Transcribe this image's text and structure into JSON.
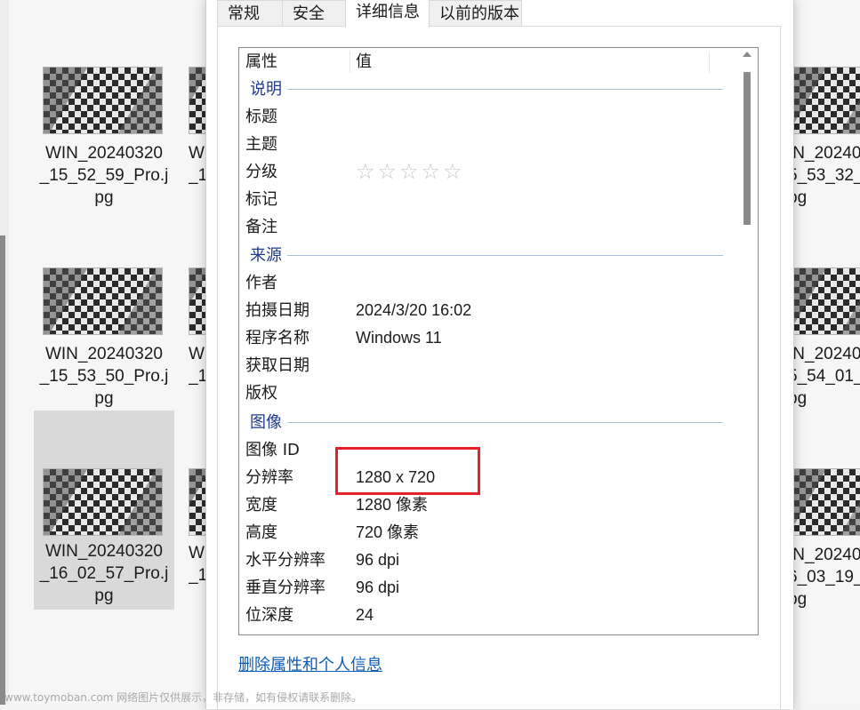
{
  "explorer": {
    "left_files": [
      "WIN_20240320\n_15_52_59_Pro.j\npg",
      "WIN_20240320\n_15_53_50_Pro.j\npg",
      "WIN_20240320\n_16_02_57_Pro.j\npg"
    ],
    "middle_partial": [
      "W\n_1",
      "W\n_1",
      "W\n_1"
    ],
    "right_partial": [
      "IN_20240\n5_53_32_\npg",
      "IN_20240\n5_54_01_\npg",
      "IN_20240\n6_03_19_\npg"
    ]
  },
  "dialog": {
    "tabs": [
      "常规",
      "安全",
      "详细信息",
      "以前的版本"
    ],
    "active_tab": "详细信息",
    "columns": {
      "property": "属性",
      "value": "值"
    },
    "groups": {
      "description": "说明",
      "origin": "来源",
      "image": "图像"
    },
    "rows": {
      "title": {
        "label": "标题",
        "value": ""
      },
      "subject": {
        "label": "主题",
        "value": ""
      },
      "rating": {
        "label": "分级",
        "value": "☆☆☆☆☆"
      },
      "tags": {
        "label": "标记",
        "value": ""
      },
      "comments": {
        "label": "备注",
        "value": ""
      },
      "author": {
        "label": "作者",
        "value": ""
      },
      "date_taken": {
        "label": "拍摄日期",
        "value": "2024/3/20 16:02"
      },
      "program": {
        "label": "程序名称",
        "value": "Windows 11"
      },
      "date_acquired": {
        "label": "获取日期",
        "value": ""
      },
      "copyright": {
        "label": "版权",
        "value": ""
      },
      "image_id": {
        "label": "图像 ID",
        "value": ""
      },
      "dimensions": {
        "label": "分辨率",
        "value": "1280 x 720"
      },
      "width": {
        "label": "宽度",
        "value": "1280 像素"
      },
      "height": {
        "label": "高度",
        "value": "720 像素"
      },
      "h_res": {
        "label": "水平分辨率",
        "value": "96 dpi"
      },
      "v_res": {
        "label": "垂直分辨率",
        "value": "96 dpi"
      },
      "bit_depth": {
        "label": "位深度",
        "value": "24"
      }
    },
    "remove_link": "删除属性和个人信息"
  },
  "watermark": "www.toymoban.com 网络图片仅供展示，非存储，如有侵权请联系删除。",
  "colors": {
    "highlight": "#e8202a",
    "group_label": "#1e3a8c",
    "link": "#0a5cb8"
  }
}
